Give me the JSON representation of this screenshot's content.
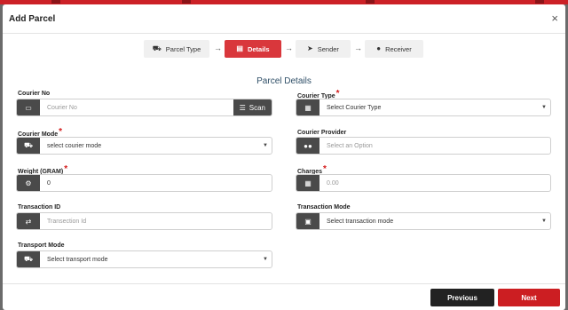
{
  "modal": {
    "title": "Add Parcel",
    "close_icon": "×"
  },
  "steps": [
    {
      "label": "Parcel Type",
      "icon": "package-icon",
      "glyph": "⛟"
    },
    {
      "label": "Details",
      "icon": "list-icon",
      "glyph": "▤",
      "active": true
    },
    {
      "label": "Sender",
      "icon": "send-icon",
      "glyph": "➤"
    },
    {
      "label": "Receiver",
      "icon": "user-icon",
      "glyph": "●"
    }
  ],
  "step_arrow": "→",
  "section_title": "Parcel Details",
  "fields": {
    "courier_no": {
      "label": "Courier No",
      "placeholder": "Courier No",
      "icon": "barcode-icon",
      "scan_label": "Scan"
    },
    "courier_type": {
      "label": "Courier Type",
      "required": "*",
      "value": "Select Courier Type",
      "icon": "grid-icon"
    },
    "courier_mode": {
      "label": "Courier Mode",
      "required": "*",
      "value": "select courier mode",
      "icon": "truck-icon"
    },
    "courier_provider": {
      "label": "Courier Provider",
      "placeholder": "Select an Option",
      "icon": "users-icon"
    },
    "weight": {
      "label": "Weight (GRAM)",
      "required": "*",
      "value": "0",
      "icon": "gears-icon"
    },
    "charges": {
      "label": "Charges",
      "required": "*",
      "placeholder": "0.00",
      "icon": "calendar-icon"
    },
    "transaction_id": {
      "label": "Transaction ID",
      "placeholder": "Transection Id",
      "icon": "exchange-icon"
    },
    "transaction_mode": {
      "label": "Transaction Mode",
      "value": "Select transaction mode",
      "icon": "money-icon"
    },
    "transport_mode": {
      "label": "Transport Mode",
      "value": "Select transport mode",
      "icon": "truck-icon"
    }
  },
  "footer": {
    "previous_label": "Previous",
    "next_label": "Next"
  },
  "colors": {
    "accent": "#cc1e22",
    "dark": "#222222",
    "addon": "#4a4a4a"
  }
}
